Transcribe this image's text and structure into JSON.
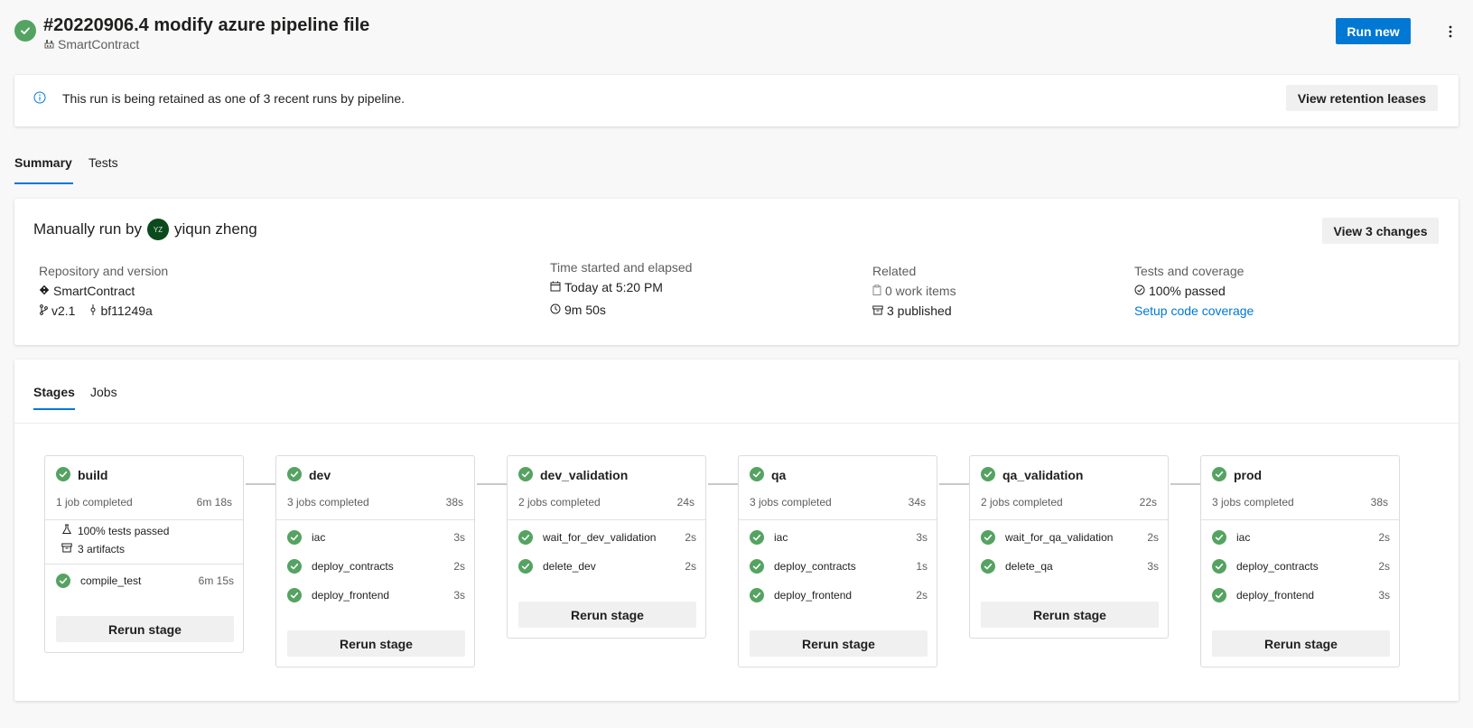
{
  "header": {
    "title": "#20220906.4 modify azure pipeline file",
    "project": "SmartContract",
    "run_new": "Run new"
  },
  "banner": {
    "text": "This run is being retained as one of 3 recent runs by pipeline.",
    "button": "View retention leases"
  },
  "tabs": [
    {
      "label": "Summary"
    },
    {
      "label": "Tests"
    }
  ],
  "summary": {
    "manual_prefix": "Manually run by",
    "avatar_initials": "YZ",
    "user": "yiqun zheng",
    "view_changes": "View 3 changes",
    "repo": {
      "heading": "Repository and version",
      "name": "SmartContract",
      "branch": "v2.1",
      "commit": "bf11249a"
    },
    "time": {
      "heading": "Time started and elapsed",
      "started": "Today at 5:20 PM",
      "elapsed": "9m 50s"
    },
    "related": {
      "heading": "Related",
      "work_items": "0 work items",
      "published": "3 published"
    },
    "tests": {
      "heading": "Tests and coverage",
      "passed": "100% passed",
      "setup": "Setup code coverage"
    }
  },
  "stage_tabs": [
    {
      "label": "Stages"
    },
    {
      "label": "Jobs"
    }
  ],
  "stages": [
    {
      "name": "build",
      "meta": "1 job completed",
      "duration": "6m 18s",
      "extras": [
        "100% tests passed",
        "3 artifacts"
      ],
      "jobs": [
        {
          "name": "compile_test",
          "duration": "6m 15s"
        }
      ],
      "rerun": "Rerun stage"
    },
    {
      "name": "dev",
      "meta": "3 jobs completed",
      "duration": "38s",
      "jobs": [
        {
          "name": "iac",
          "duration": "3s"
        },
        {
          "name": "deploy_contracts",
          "duration": "2s"
        },
        {
          "name": "deploy_frontend",
          "duration": "3s"
        }
      ],
      "rerun": "Rerun stage"
    },
    {
      "name": "dev_validation",
      "meta": "2 jobs completed",
      "duration": "24s",
      "jobs": [
        {
          "name": "wait_for_dev_validation",
          "duration": "2s"
        },
        {
          "name": "delete_dev",
          "duration": "2s"
        }
      ],
      "rerun": "Rerun stage"
    },
    {
      "name": "qa",
      "meta": "3 jobs completed",
      "duration": "34s",
      "jobs": [
        {
          "name": "iac",
          "duration": "3s"
        },
        {
          "name": "deploy_contracts",
          "duration": "1s"
        },
        {
          "name": "deploy_frontend",
          "duration": "2s"
        }
      ],
      "rerun": "Rerun stage"
    },
    {
      "name": "qa_validation",
      "meta": "2 jobs completed",
      "duration": "22s",
      "jobs": [
        {
          "name": "wait_for_qa_validation",
          "duration": "2s"
        },
        {
          "name": "delete_qa",
          "duration": "3s"
        }
      ],
      "rerun": "Rerun stage"
    },
    {
      "name": "prod",
      "meta": "3 jobs completed",
      "duration": "38s",
      "jobs": [
        {
          "name": "iac",
          "duration": "2s"
        },
        {
          "name": "deploy_contracts",
          "duration": "2s"
        },
        {
          "name": "deploy_frontend",
          "duration": "3s"
        }
      ],
      "rerun": "Rerun stage"
    }
  ],
  "colors": {
    "success": "#55a362",
    "primary": "#0078d4"
  }
}
